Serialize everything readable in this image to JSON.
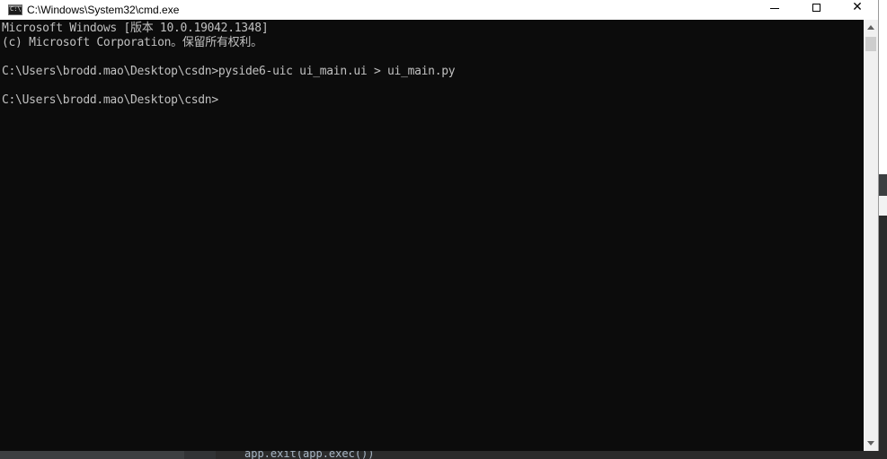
{
  "window": {
    "title": "C:\\Windows\\System32\\cmd.exe",
    "app_icon_glyph": "C:\\",
    "controls": {
      "minimize": "minimize",
      "maximize": "maximize",
      "close": "✕"
    }
  },
  "console": {
    "lines": [
      "Microsoft Windows [版本 10.0.19042.1348]",
      "(c) Microsoft Corporation。保留所有权利。",
      "",
      "C:\\Users\\brodd.mao\\Desktop\\csdn>pyside6-uic ui_main.ui > ui_main.py",
      "",
      "C:\\Users\\brodd.mao\\Desktop\\csdn>"
    ]
  },
  "background": {
    "code_snippet": "app.exit(app.exec())"
  },
  "colors": {
    "console_bg": "#0c0c0c",
    "console_text": "#c0c0c0",
    "titlebar_bg": "#ffffff"
  }
}
